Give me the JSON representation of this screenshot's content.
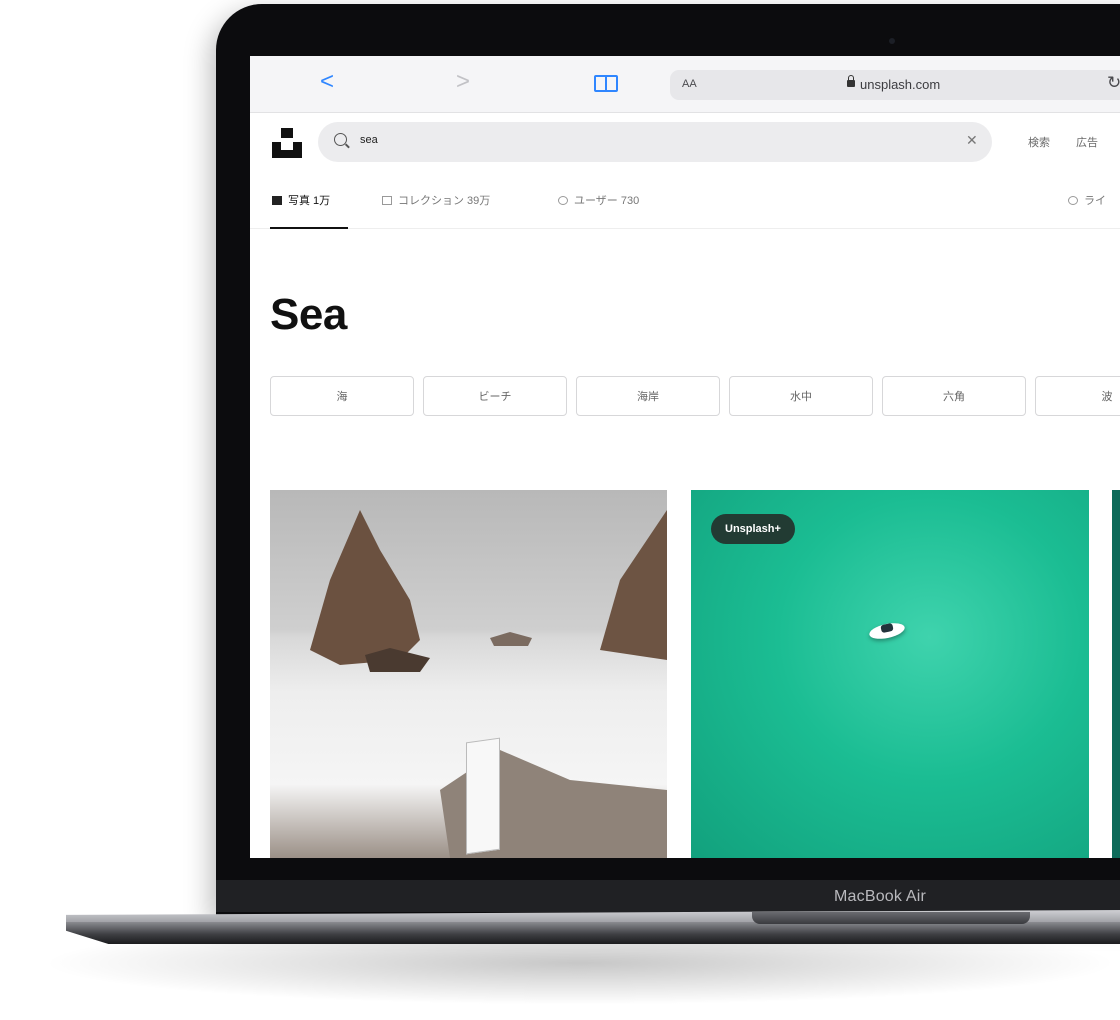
{
  "device": {
    "model_label": "MacBook Air"
  },
  "browser": {
    "address_text_size": "AA",
    "url": "unsplash.com",
    "back_icon": "chevron-left-icon",
    "forward_icon": "chevron-right-icon",
    "bookmarks_icon": "book-icon",
    "reload_icon": "reload-icon",
    "accent_color": "#2f86ff"
  },
  "header": {
    "search_value": "sea",
    "links": [
      "検索",
      "広告"
    ]
  },
  "tabs": [
    {
      "label": "写真 1万",
      "active": true
    },
    {
      "label": "コレクション 39万",
      "active": false
    },
    {
      "label": "ユーザー 730",
      "active": false
    },
    {
      "label": "ライ",
      "active": false
    }
  ],
  "page": {
    "title": "Sea"
  },
  "chips": [
    "海",
    "ビーチ",
    "海岸",
    "水中",
    "六角",
    "波"
  ],
  "photos": [
    {
      "badge": ""
    },
    {
      "badge": "Unsplash+"
    }
  ]
}
